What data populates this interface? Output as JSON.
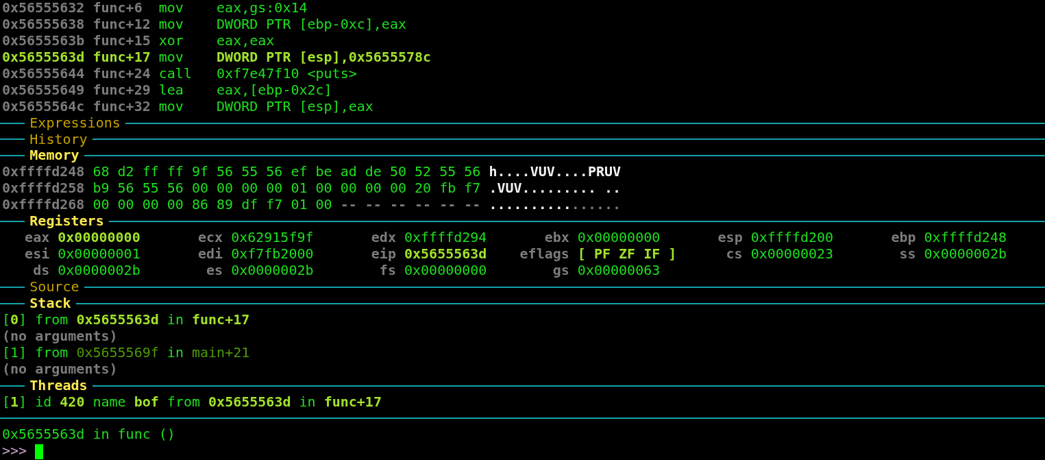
{
  "assembly": [
    {
      "address": "0x56555632",
      "offset": "func+6",
      "mnemonic": "mov",
      "operands": "eax,gs:0x14",
      "current": false
    },
    {
      "address": "0x56555638",
      "offset": "func+12",
      "mnemonic": "mov",
      "operands": "DWORD PTR [ebp-0xc],eax",
      "current": false
    },
    {
      "address": "0x5655563b",
      "offset": "func+15",
      "mnemonic": "xor",
      "operands": "eax,eax",
      "current": false
    },
    {
      "address": "0x5655563d",
      "offset": "func+17",
      "mnemonic": "mov",
      "operands": "DWORD PTR [esp],0x5655578c",
      "current": true
    },
    {
      "address": "0x56555644",
      "offset": "func+24",
      "mnemonic": "call",
      "operands": "0xf7e47f10 <puts>",
      "current": false
    },
    {
      "address": "0x56555649",
      "offset": "func+29",
      "mnemonic": "lea",
      "operands": "eax,[ebp-0x2c]",
      "current": false
    },
    {
      "address": "0x5655564c",
      "offset": "func+32",
      "mnemonic": "mov",
      "operands": "DWORD PTR [esp],eax",
      "current": false
    }
  ],
  "panels": [
    {
      "kind": "empty",
      "title": "Expressions",
      "highlighted": false
    },
    {
      "kind": "empty",
      "title": "History",
      "highlighted": false
    },
    {
      "kind": "memory",
      "title": "Memory",
      "highlighted": true,
      "rows": [
        {
          "address": "0xffffd248",
          "bytes": "68 d2 ff ff 9f 56 55 56 ef be ad de 50 52 55 56",
          "ascii": "h....VUV....PRUV"
        },
        {
          "address": "0xffffd258",
          "bytes": "b9 56 55 56 00 00 00 00 01 00 00 00 00 20 fb f7",
          "ascii": ".VUV......... .."
        },
        {
          "address": "0xffffd268",
          "bytes": "00 00 00 00 86 89 df f7 01 00",
          "padding": "-- -- -- -- -- --",
          "ascii": "..........",
          "ascii_padding": "......"
        }
      ]
    },
    {
      "kind": "registers",
      "title": "Registers",
      "highlighted": true,
      "registers": [
        {
          "name": "eax",
          "value": "0x00000000",
          "changed": true
        },
        {
          "name": "ecx",
          "value": "0x62915f9f",
          "changed": false
        },
        {
          "name": "edx",
          "value": "0xffffd294",
          "changed": false
        },
        {
          "name": "ebx",
          "value": "0x00000000",
          "changed": false
        },
        {
          "name": "esp",
          "value": "0xffffd200",
          "changed": false
        },
        {
          "name": "ebp",
          "value": "0xffffd248",
          "changed": false
        },
        {
          "name": "esi",
          "value": "0x00000001",
          "changed": false
        },
        {
          "name": "edi",
          "value": "0xf7fb2000",
          "changed": false
        },
        {
          "name": "eip",
          "value": "0x5655563d",
          "changed": true
        },
        {
          "name": "eflags",
          "value": "[ PF ZF IF ]",
          "changed": true
        },
        {
          "name": "cs",
          "value": "0x00000023",
          "changed": false
        },
        {
          "name": "ss",
          "value": "0x0000002b",
          "changed": false
        },
        {
          "name": "ds",
          "value": "0x0000002b",
          "changed": false
        },
        {
          "name": "es",
          "value": "0x0000002b",
          "changed": false
        },
        {
          "name": "fs",
          "value": "0x00000000",
          "changed": false
        },
        {
          "name": "gs",
          "value": "0x00000063",
          "changed": false
        }
      ]
    },
    {
      "kind": "empty",
      "title": "Source",
      "highlighted": false
    },
    {
      "kind": "lines",
      "title": "Stack",
      "highlighted": true,
      "lines": [
        [
          {
            "text": "[",
            "kind": "text"
          },
          {
            "text": "0",
            "kind": "value"
          },
          {
            "text": "] from ",
            "kind": "text"
          },
          {
            "text": "0x5655563d",
            "kind": "value"
          },
          {
            "text": " in ",
            "kind": "text"
          },
          {
            "text": "func+17",
            "kind": "value"
          }
        ],
        [
          {
            "text": "(no arguments)",
            "kind": "note"
          }
        ],
        [
          {
            "text": "[1] from ",
            "kind": "text"
          },
          {
            "text": "0x5655569f",
            "kind": "caller"
          },
          {
            "text": " in ",
            "kind": "text"
          },
          {
            "text": "main+21",
            "kind": "caller"
          }
        ],
        [
          {
            "text": "(no arguments)",
            "kind": "note"
          }
        ]
      ]
    },
    {
      "kind": "lines",
      "title": "Threads",
      "highlighted": true,
      "lines": [
        [
          {
            "text": "[",
            "kind": "text"
          },
          {
            "text": "1",
            "kind": "value"
          },
          {
            "text": "] id ",
            "kind": "text"
          },
          {
            "text": "420",
            "kind": "value"
          },
          {
            "text": " name ",
            "kind": "text"
          },
          {
            "text": "bof",
            "kind": "value"
          },
          {
            "text": " from ",
            "kind": "text"
          },
          {
            "text": "0x5655563d",
            "kind": "value"
          },
          {
            "text": " in ",
            "kind": "text"
          },
          {
            "text": "func+17",
            "kind": "value"
          }
        ]
      ]
    }
  ],
  "console": {
    "output": "0x5655563d in func ()",
    "prompt": ">>>"
  }
}
